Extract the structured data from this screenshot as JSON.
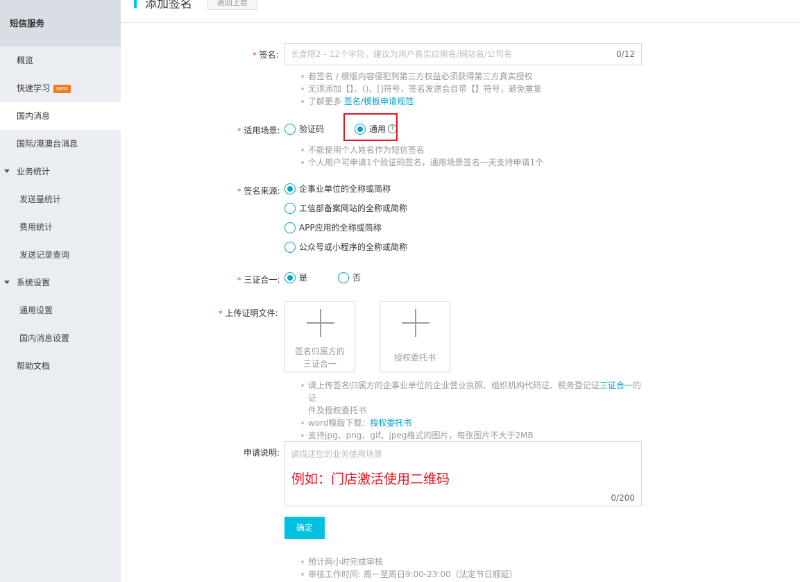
{
  "sidebar": {
    "title": "短信服务",
    "items": [
      {
        "label": "概览"
      },
      {
        "label": "快速学习",
        "badge": "NEW"
      },
      {
        "label": "国内消息"
      },
      {
        "label": "国际/港澳台消息"
      },
      {
        "label": "业务统计"
      },
      {
        "label": "发送量统计"
      },
      {
        "label": "费用统计"
      },
      {
        "label": "发送记录查询"
      },
      {
        "label": "系统设置"
      },
      {
        "label": "通用设置"
      },
      {
        "label": "国内消息设置"
      },
      {
        "label": "帮助文档"
      }
    ]
  },
  "header": {
    "title": "添加签名",
    "back_label": "返回上层"
  },
  "form": {
    "signature": {
      "label": "签名:",
      "placeholder": "长度限2 - 12个字符，建议为用户真实应用名/网站名/公司名",
      "counter": "0/12",
      "hints": [
        "若签名 / 模版内容侵犯到第三方权益必须获得第三方真实授权",
        "无须添加【】、()、[]符号，签名发送会自带【】符号，避免重复"
      ],
      "more_prefix": "了解更多 ",
      "more_link": "签名/模板申请规范"
    },
    "scenario": {
      "label": "适用场景:",
      "options": [
        "验证码",
        "通用"
      ],
      "selected": "通用",
      "help_icon": "question-circle-icon",
      "help_symbol": "?",
      "hints": [
        "不能使用个人姓名作为短信签名",
        "个人用户可申请1个验证码签名，通用场景签名一天支持申请1个"
      ]
    },
    "source": {
      "label": "签名来源:",
      "options": [
        "企事业单位的全称或简称",
        "工信部备案网站的全称或简称",
        "APP应用的全称或简称",
        "公众号或小程序的全称或简称"
      ],
      "selected": "企事业单位的全称或简称"
    },
    "three_in_one": {
      "label": "三证合一:",
      "options": [
        "是",
        "否"
      ],
      "selected": "是"
    },
    "upload": {
      "label": "上传证明文件:",
      "boxes": [
        {
          "line1": "签名归属方的",
          "line2": "三证合一"
        },
        {
          "line1": "授权委托书"
        }
      ],
      "hint1_prefix": "请上传签名归属方的企事业单位的企业营业执照、组织机构代码证、税务登记证",
      "hint1_link": "三证合一",
      "hint1_suffix": "的证",
      "hint1_line2": "件及授权委托书",
      "hint2_prefix": "word模版下载：",
      "hint2_link": "授权委托书",
      "hint3": "支持jpg、png、gif、jpeg格式的图片，每张图片不大于2MB"
    },
    "description": {
      "label": "申请说明:",
      "placeholder": "请描述您的业务使用场景",
      "annotation": "例如：门店激活使用二维码",
      "counter": "0/200"
    },
    "submit_label": "确定",
    "footer_hints": [
      "预计两小时完成审核",
      "审核工作时间: 周一至周日9:00-23:00（法定节日顺延）"
    ]
  },
  "colors": {
    "accent": "#00c1de",
    "link": "#00a2ca",
    "required": "#e0301e",
    "highlight": "#e8131c",
    "new_badge": "#f27a1a"
  }
}
